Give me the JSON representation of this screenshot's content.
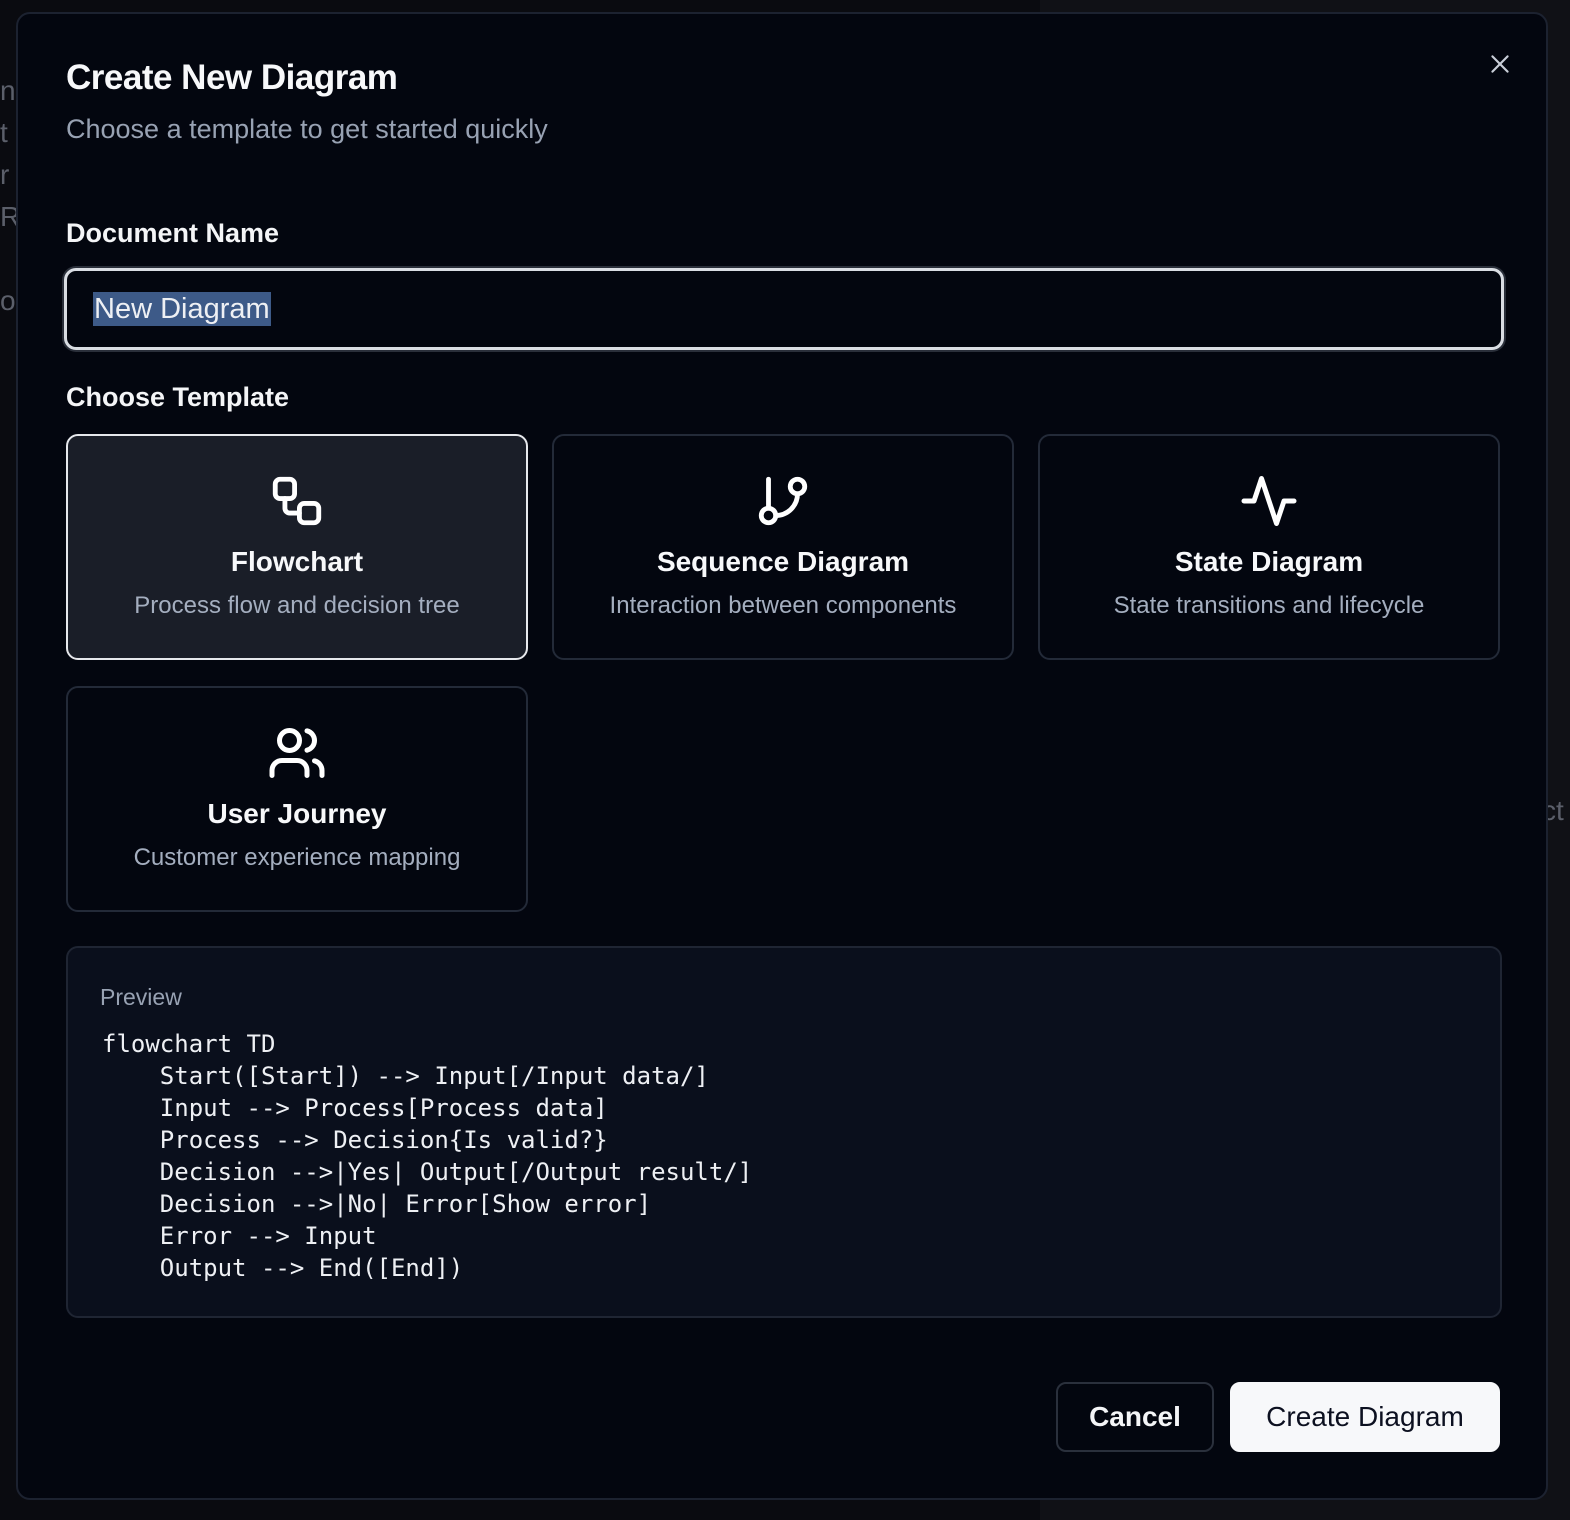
{
  "background": {
    "left_glyphs": [
      "n",
      "t",
      "r",
      "R",
      "",
      "o"
    ],
    "right_glyph": "ct"
  },
  "dialog": {
    "title": "Create New Diagram",
    "subtitle": "Choose a template to get started quickly",
    "close_icon": "close-icon"
  },
  "document_name": {
    "label": "Document Name",
    "value": "New Diagram"
  },
  "templates": {
    "label": "Choose Template",
    "selected": "Flowchart",
    "items": [
      {
        "title": "Flowchart",
        "description": "Process flow and decision tree",
        "icon": "flowchart-icon"
      },
      {
        "title": "Sequence Diagram",
        "description": "Interaction between components",
        "icon": "git-branch-icon"
      },
      {
        "title": "State Diagram",
        "description": "State transitions and lifecycle",
        "icon": "activity-icon"
      },
      {
        "title": "User Journey",
        "description": "Customer experience mapping",
        "icon": "users-icon"
      }
    ]
  },
  "preview": {
    "label": "Preview",
    "code": "flowchart TD\n    Start([Start]) --> Input[/Input data/]\n    Input --> Process[Process data]\n    Process --> Decision{Is valid?}\n    Decision -->|Yes| Output[/Output result/]\n    Decision -->|No| Error[Show error]\n    Error --> Input\n    Output --> End([End])"
  },
  "actions": {
    "cancel_label": "Cancel",
    "create_label": "Create Diagram"
  },
  "colors": {
    "dialog_bg": "#03060f",
    "selected_card_bg": "#1a1e28",
    "muted_text": "#98a2b3",
    "primary_button_bg": "#f7f8fa",
    "selection_highlight": "#3d5a88"
  }
}
